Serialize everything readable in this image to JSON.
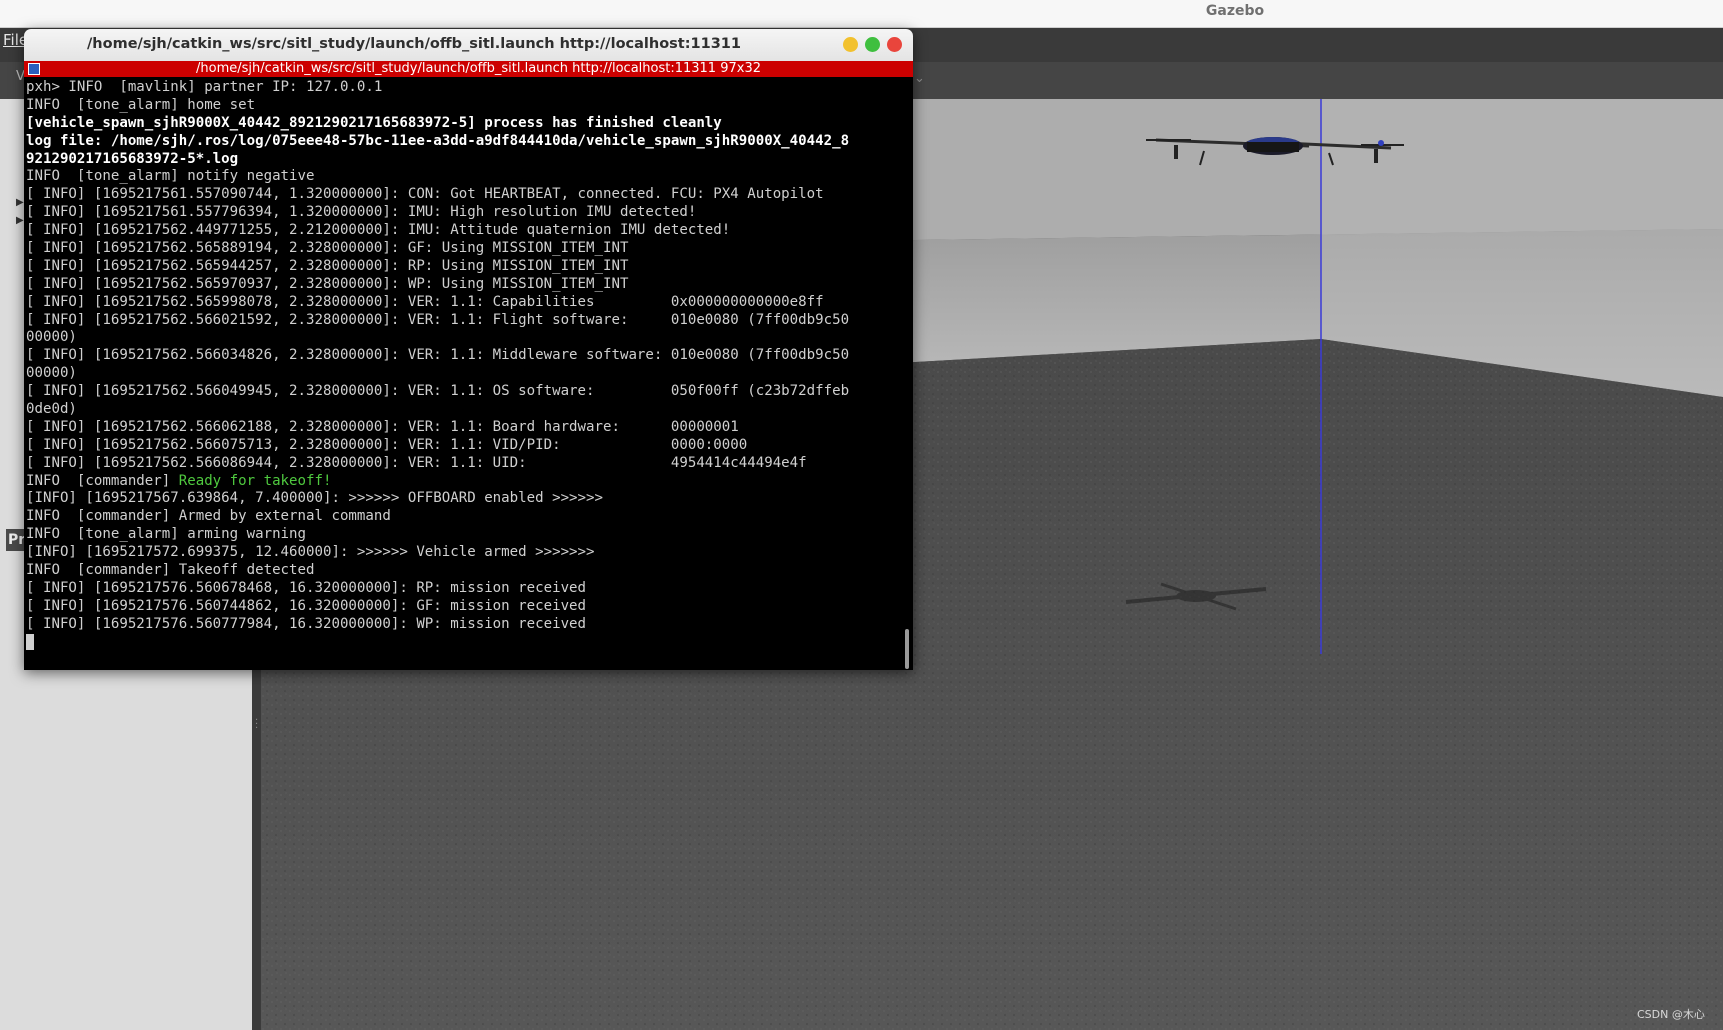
{
  "gazebo": {
    "window_title": "Gazebo",
    "menu_file": "File",
    "toolbar_letter": "V",
    "left_panel_tab": "Pr",
    "watermark": "CSDN @木心"
  },
  "terminal": {
    "title": "/home/sjh/catkin_ws/src/sitl_study/launch/offb_sitl.launch http://localhost:11311",
    "infobar": "/home/sjh/catkin_ws/src/sitl_study/launch/offb_sitl.launch http://localhost:11311 97x32",
    "lines": [
      {
        "text": "pxh> INFO  [mavlink] partner IP: 127.0.0.1",
        "style": ""
      },
      {
        "text": "INFO  [tone_alarm] home set",
        "style": ""
      },
      {
        "text": "[vehicle_spawn_sjhR9000X_40442_8921290217165683972-5] process has finished cleanly",
        "style": "b"
      },
      {
        "text": "log file: /home/sjh/.ros/log/075eee48-57bc-11ee-a3dd-a9df844410da/vehicle_spawn_sjhR9000X_40442_8",
        "style": "b"
      },
      {
        "text": "921290217165683972-5*.log",
        "style": "b"
      },
      {
        "text": "INFO  [tone_alarm] notify negative",
        "style": ""
      },
      {
        "text": "[ INFO] [1695217561.557090744, 1.320000000]: CON: Got HEARTBEAT, connected. FCU: PX4 Autopilot",
        "style": ""
      },
      {
        "text": "[ INFO] [1695217561.557796394, 1.320000000]: IMU: High resolution IMU detected!",
        "style": ""
      },
      {
        "text": "[ INFO] [1695217562.449771255, 2.212000000]: IMU: Attitude quaternion IMU detected!",
        "style": ""
      },
      {
        "text": "[ INFO] [1695217562.565889194, 2.328000000]: GF: Using MISSION_ITEM_INT",
        "style": ""
      },
      {
        "text": "[ INFO] [1695217562.565944257, 2.328000000]: RP: Using MISSION_ITEM_INT",
        "style": ""
      },
      {
        "text": "[ INFO] [1695217562.565970937, 2.328000000]: WP: Using MISSION_ITEM_INT",
        "style": ""
      },
      {
        "text": "[ INFO] [1695217562.565998078, 2.328000000]: VER: 1.1: Capabilities         0x000000000000e8ff",
        "style": ""
      },
      {
        "text": "[ INFO] [1695217562.566021592, 2.328000000]: VER: 1.1: Flight software:     010e0080 (7ff00db9c50",
        "style": ""
      },
      {
        "text": "00000)",
        "style": ""
      },
      {
        "text": "[ INFO] [1695217562.566034826, 2.328000000]: VER: 1.1: Middleware software: 010e0080 (7ff00db9c50",
        "style": ""
      },
      {
        "text": "00000)",
        "style": ""
      },
      {
        "text": "[ INFO] [1695217562.566049945, 2.328000000]: VER: 1.1: OS software:         050f00ff (c23b72dffeb",
        "style": ""
      },
      {
        "text": "0de0d)",
        "style": ""
      },
      {
        "text": "[ INFO] [1695217562.566062188, 2.328000000]: VER: 1.1: Board hardware:      00000001",
        "style": ""
      },
      {
        "text": "[ INFO] [1695217562.566075713, 2.328000000]: VER: 1.1: VID/PID:             0000:0000",
        "style": ""
      },
      {
        "text": "[ INFO] [1695217562.566086944, 2.328000000]: VER: 1.1: UID:                 4954414c44494e4f",
        "style": ""
      },
      {
        "text": "INFO  [commander] ",
        "style": "",
        "green": "Ready for takeoff!"
      },
      {
        "text": "[INFO] [1695217567.639864, 7.400000]: >>>>>> OFFBOARD enabled >>>>>>",
        "style": ""
      },
      {
        "text": "INFO  [commander] Armed by external command",
        "style": ""
      },
      {
        "text": "INFO  [tone_alarm] arming warning",
        "style": ""
      },
      {
        "text": "[INFO] [1695217572.699375, 12.460000]: >>>>>> Vehicle armed >>>>>>>",
        "style": ""
      },
      {
        "text": "INFO  [commander] Takeoff detected",
        "style": ""
      },
      {
        "text": "[ INFO] [1695217576.560678468, 16.320000000]: RP: mission received",
        "style": ""
      },
      {
        "text": "[ INFO] [1695217576.560744862, 16.320000000]: GF: mission received",
        "style": ""
      },
      {
        "text": "[ INFO] [1695217576.560777984, 16.320000000]: WP: mission received",
        "style": ""
      }
    ]
  }
}
